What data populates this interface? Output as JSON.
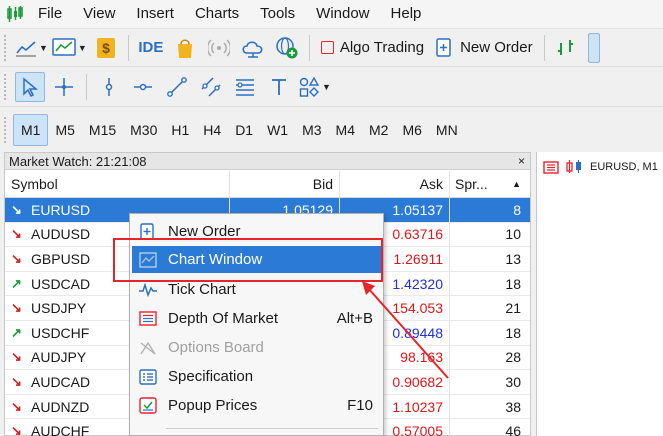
{
  "menubar": {
    "items": [
      "File",
      "View",
      "Insert",
      "Charts",
      "Tools",
      "Window",
      "Help"
    ]
  },
  "toolbar": {
    "ide_label": "IDE",
    "algo_trading_label": "Algo Trading",
    "new_order_label": "New Order"
  },
  "timeframes": [
    "M1",
    "M5",
    "M15",
    "M30",
    "H1",
    "H4",
    "D1",
    "W1",
    "M3",
    "M4",
    "M2",
    "M6",
    "MN"
  ],
  "market_watch": {
    "title": "Market Watch: 21:21:08",
    "close": "×",
    "columns": {
      "symbol": "Symbol",
      "bid": "Bid",
      "ask": "Ask",
      "spread": "Spr..."
    },
    "rows": [
      {
        "symbol": "EURUSD",
        "bid": "1.05129",
        "ask": "1.05137",
        "spread": "8",
        "dir": "down"
      },
      {
        "symbol": "AUDUSD",
        "bid": "",
        "ask": "0.63716",
        "spread": "10",
        "dir": "down"
      },
      {
        "symbol": "GBPUSD",
        "bid": "",
        "ask": "1.26911",
        "spread": "13",
        "dir": "down"
      },
      {
        "symbol": "USDCAD",
        "bid": "",
        "ask": "1.42320",
        "spread": "18",
        "dir": "up"
      },
      {
        "symbol": "USDJPY",
        "bid": "",
        "ask": "154.053",
        "spread": "21",
        "dir": "down"
      },
      {
        "symbol": "USDCHF",
        "bid": "",
        "ask": "0.89448",
        "spread": "18",
        "dir": "up"
      },
      {
        "symbol": "AUDJPY",
        "bid": "",
        "ask": "98.163",
        "spread": "28",
        "dir": "down"
      },
      {
        "symbol": "AUDCAD",
        "bid": "",
        "ask": "0.90682",
        "spread": "30",
        "dir": "down"
      },
      {
        "symbol": "AUDNZD",
        "bid": "",
        "ask": "1.10237",
        "spread": "38",
        "dir": "down"
      },
      {
        "symbol": "AUDCHF",
        "bid": "",
        "ask": "0.57005",
        "spread": "46",
        "dir": "down"
      }
    ]
  },
  "chart_panel": {
    "tab_label": "EURUSD, M1"
  },
  "context_menu": {
    "items": [
      {
        "label": "New Order",
        "shortcut": ""
      },
      {
        "label": "Chart Window",
        "shortcut": ""
      },
      {
        "label": "Tick Chart",
        "shortcut": ""
      },
      {
        "label": "Depth Of Market",
        "shortcut": "Alt+B"
      },
      {
        "label": "Options Board",
        "shortcut": ""
      },
      {
        "label": "Specification",
        "shortcut": ""
      },
      {
        "label": "Popup Prices",
        "shortcut": "F10"
      }
    ]
  },
  "colors": {
    "selection": "#2b7bd6",
    "annotation": "#e8232b",
    "ask_red": "#e0161b",
    "ask_blue": "#1f2ee0"
  }
}
